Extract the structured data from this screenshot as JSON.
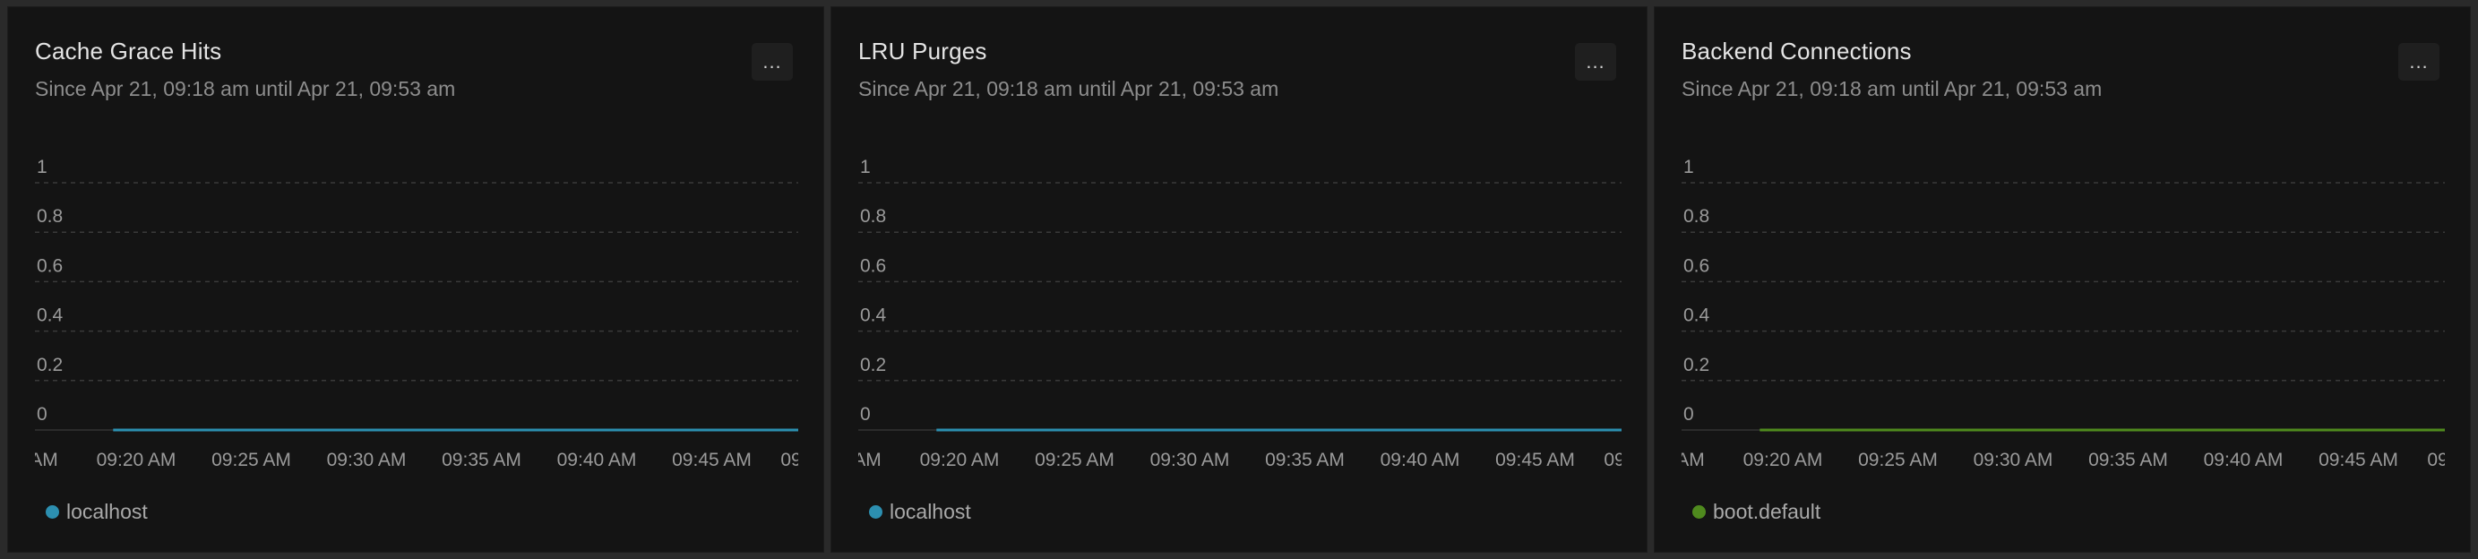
{
  "panels": [
    {
      "title": "Cache Grace Hits",
      "subtitle": "Since Apr 21, 09:18 am until Apr 21, 09:53 am",
      "menu_label": "...",
      "legend": {
        "label": "localhost",
        "color": "#2c8fb0"
      }
    },
    {
      "title": "LRU Purges",
      "subtitle": "Since Apr 21, 09:18 am until Apr 21, 09:53 am",
      "menu_label": "...",
      "legend": {
        "label": "localhost",
        "color": "#2c8fb0"
      }
    },
    {
      "title": "Backend Connections",
      "subtitle": "Since Apr 21, 09:18 am until Apr 21, 09:53 am",
      "menu_label": "...",
      "legend": {
        "label": "boot.default",
        "color": "#4f8a1e"
      }
    }
  ],
  "chart_data": [
    {
      "type": "line",
      "title": "Cache Grace Hits",
      "y_ticks": [
        "1",
        "0.8",
        "0.6",
        "0.4",
        "0.2",
        "0"
      ],
      "ylim": [
        0,
        1
      ],
      "x_ticks": [
        "AM",
        "09:20 AM",
        "09:25 AM",
        "09:30 AM",
        "09:35 AM",
        "09:40 AM",
        "09:45 AM",
        "09"
      ],
      "grid": true,
      "legend_position": "bottom-left",
      "series": [
        {
          "name": "localhost",
          "color": "#2c8fb0",
          "x": [
            "09:19 AM",
            "09:53 AM"
          ],
          "values": [
            0,
            0
          ]
        }
      ]
    },
    {
      "type": "line",
      "title": "LRU Purges",
      "y_ticks": [
        "1",
        "0.8",
        "0.6",
        "0.4",
        "0.2",
        "0"
      ],
      "ylim": [
        0,
        1
      ],
      "x_ticks": [
        "AM",
        "09:20 AM",
        "09:25 AM",
        "09:30 AM",
        "09:35 AM",
        "09:40 AM",
        "09:45 AM",
        "09"
      ],
      "grid": true,
      "legend_position": "bottom-left",
      "series": [
        {
          "name": "localhost",
          "color": "#2c8fb0",
          "x": [
            "09:19 AM",
            "09:53 AM"
          ],
          "values": [
            0,
            0
          ]
        }
      ]
    },
    {
      "type": "line",
      "title": "Backend Connections",
      "y_ticks": [
        "1",
        "0.8",
        "0.6",
        "0.4",
        "0.2",
        "0"
      ],
      "ylim": [
        0,
        1
      ],
      "x_ticks": [
        "AM",
        "09:20 AM",
        "09:25 AM",
        "09:30 AM",
        "09:35 AM",
        "09:40 AM",
        "09:45 AM",
        "09"
      ],
      "grid": true,
      "legend_position": "bottom-left",
      "series": [
        {
          "name": "boot.default",
          "color": "#4f8a1e",
          "x": [
            "09:19 AM",
            "09:53 AM"
          ],
          "values": [
            0,
            0
          ]
        }
      ]
    }
  ]
}
